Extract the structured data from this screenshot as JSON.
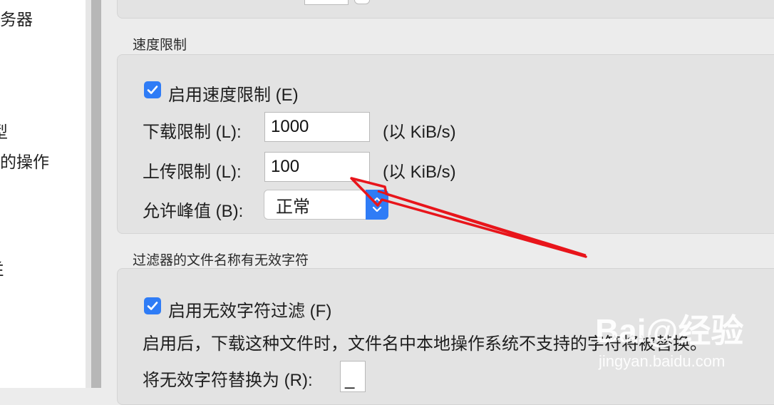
{
  "sidebar": {
    "items": [
      "务器",
      "型",
      "的操作",
      "Ĕ"
    ]
  },
  "speed_limit": {
    "section_title": "速度限制",
    "enable_label": "启用速度限制 (E)",
    "enable_checked": true,
    "download_label": "下载限制 (L):",
    "download_value": "1000",
    "download_unit": "(以 KiB/s)",
    "upload_label": "上传限制 (L):",
    "upload_value": "100",
    "upload_unit": "(以 KiB/s)",
    "burst_label": "允许峰值 (B):",
    "burst_value": "正常"
  },
  "invalid_chars": {
    "section_title": "过滤器的文件名称有无效字符",
    "enable_label": "启用无效字符过滤 (F)",
    "enable_checked": true,
    "description": "启用后，下载这种文件时，文件名中本地操作系统不支持的字符将被替换。",
    "replace_label": "将无效字符替换为 (R):",
    "replace_value": "_"
  },
  "watermark": {
    "brand": "Bai@经验",
    "url": "jingyan.baidu.com"
  },
  "colors": {
    "accent": "#2f7cf6",
    "annotation_arrow": "#e8151b"
  }
}
